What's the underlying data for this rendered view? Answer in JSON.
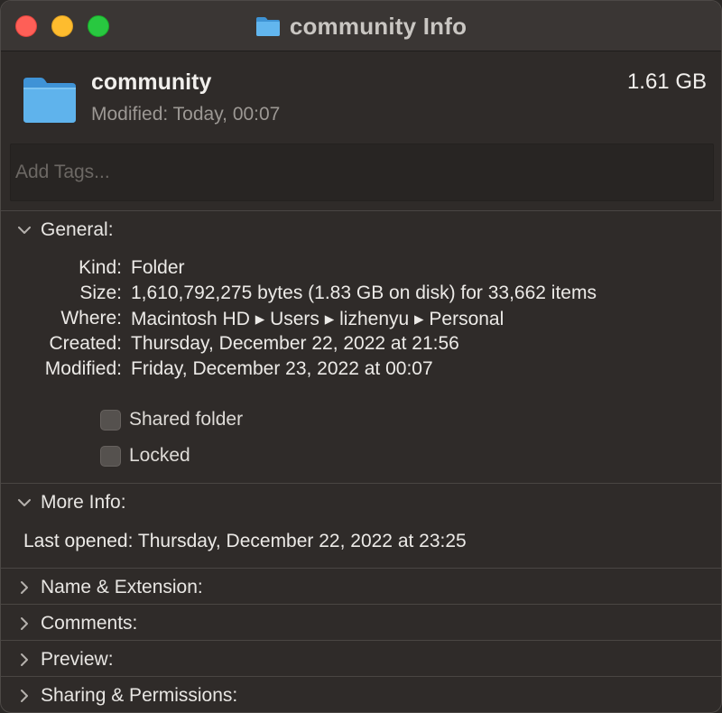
{
  "window": {
    "title": "community Info"
  },
  "header": {
    "name": "community",
    "size": "1.61 GB",
    "modified": "Modified: Today, 00:07",
    "tags_placeholder": "Add Tags..."
  },
  "general": {
    "section_label": "General:",
    "rows": [
      {
        "label": "Kind:",
        "value": "Folder"
      },
      {
        "label": "Size:",
        "value": "1,610,792,275 bytes (1.83 GB on disk) for 33,662 items"
      },
      {
        "label": "Where:",
        "value": "Macintosh HD ▸ Users ▸ lizhenyu ▸ Personal"
      },
      {
        "label": "Created:",
        "value": "Thursday, December 22, 2022 at 21:56"
      },
      {
        "label": "Modified:",
        "value": "Friday, December 23, 2022 at 00:07"
      }
    ],
    "shared_folder_label": "Shared folder",
    "locked_label": "Locked"
  },
  "more_info": {
    "section_label": "More Info:",
    "last_opened": "Last opened: Thursday, December 22, 2022 at 23:25"
  },
  "collapsed_sections": [
    "Name & Extension:",
    "Comments:",
    "Preview:",
    "Sharing & Permissions:"
  ],
  "colors": {
    "close": "#fe5f57",
    "minimize": "#febc2e",
    "maximize": "#28c840",
    "folder": "#5ab0ea"
  },
  "icons": {
    "title_icon": "folder-icon",
    "header_icon": "folder-icon",
    "expanded_chevron": "chevron-down-icon",
    "collapsed_chevron": "chevron-right-icon"
  }
}
